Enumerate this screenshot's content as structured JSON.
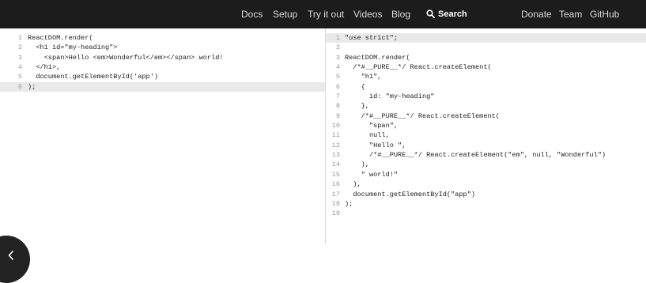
{
  "nav": {
    "links": [
      "Docs",
      "Setup",
      "Try it out",
      "Videos",
      "Blog"
    ],
    "search_label": "Search",
    "right_links": [
      "Donate",
      "Team",
      "GitHub"
    ]
  },
  "editor": {
    "lines": [
      {
        "n": "1",
        "text": "ReactDOM.render("
      },
      {
        "n": "2",
        "text": "  <h1 id=\"my-heading\">"
      },
      {
        "n": "3",
        "text": "    <span>Hello <em>Wonderful</em></span> world!"
      },
      {
        "n": "4",
        "text": "  </h1>,"
      },
      {
        "n": "5",
        "text": "  document.getElementById('app')"
      },
      {
        "n": "6",
        "text": ");"
      }
    ]
  },
  "output": {
    "lines": [
      {
        "n": "1",
        "text": "\"use strict\";"
      },
      {
        "n": "2",
        "text": ""
      },
      {
        "n": "3",
        "text": "ReactDOM.render("
      },
      {
        "n": "4",
        "text": "  /*#__PURE__*/ React.createElement("
      },
      {
        "n": "5",
        "text": "    \"h1\","
      },
      {
        "n": "6",
        "text": "    {"
      },
      {
        "n": "7",
        "text": "      id: \"my-heading\""
      },
      {
        "n": "8",
        "text": "    },"
      },
      {
        "n": "9",
        "text": "    /*#__PURE__*/ React.createElement("
      },
      {
        "n": "10",
        "text": "      \"span\","
      },
      {
        "n": "11",
        "text": "      null,"
      },
      {
        "n": "12",
        "text": "      \"Hello \","
      },
      {
        "n": "13",
        "text": "      /*#__PURE__*/ React.createElement(\"em\", null, \"Wonderful\")"
      },
      {
        "n": "14",
        "text": "    ),"
      },
      {
        "n": "15",
        "text": "    \" world!\""
      },
      {
        "n": "16",
        "text": "  ),"
      },
      {
        "n": "17",
        "text": "  document.getElementById(\"app\")"
      },
      {
        "n": "18",
        "text": ");"
      },
      {
        "n": "19",
        "text": ""
      }
    ]
  },
  "icons": {
    "search": "search-icon",
    "collapse": "chevron-left-icon"
  },
  "colors": {
    "topbar": "#1c1c1c",
    "active_line": "#e9e9e9"
  }
}
